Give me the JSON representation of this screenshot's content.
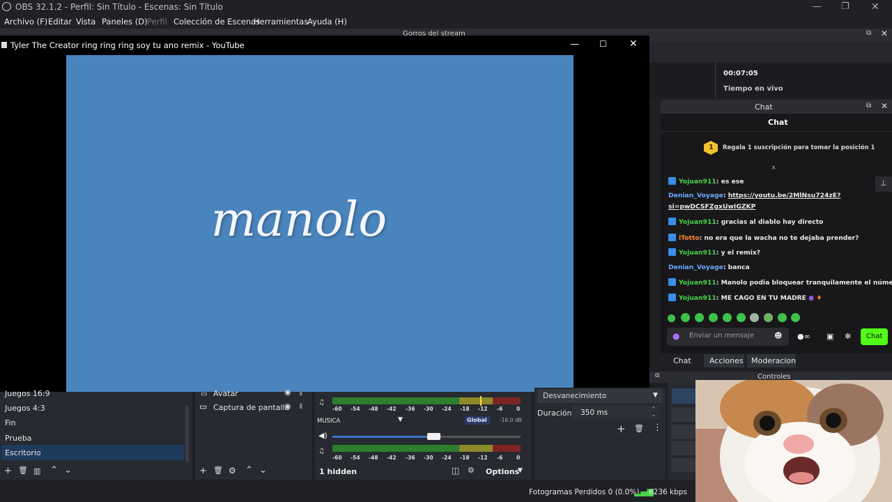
{
  "window": {
    "title": "OBS 32.1.2 - Perfil: Sin Título - Escenas: Sin Título"
  },
  "menu": {
    "items": [
      "Archivo (F)",
      "Editar",
      "Vista",
      "Paneles (D)",
      "Perfil",
      "Colección de Escenas",
      "Herramientas",
      "Ayuda (H)"
    ]
  },
  "bg_dock_title": "Gorros del stream",
  "youtube": {
    "title": "Tyler The Creator ring ring ring soy tu ano remix - YouTube",
    "video_text": "manolo"
  },
  "stats": {
    "time": "00:07:05",
    "live_label": "Tiempo en vivo"
  },
  "chat": {
    "dock_title": "Chat",
    "header": "Chat",
    "sub_rank": "1",
    "sub_text": "Regala 1 suscripción para tomar la posición 1",
    "messages": [
      {
        "user": "Yojuan911",
        "text": ": es ese"
      },
      {
        "user": "Denian_Voyage",
        "text": ": ",
        "link": "https://youtu.be/2MlNsu724zE?",
        "link2": "si=pwDCSFZgxUwIGZKP"
      },
      {
        "user": "Yojuan911",
        "text": ": gracias al diablo hay directo"
      },
      {
        "user": "iTotto",
        "text": ": no era que la wacha no te dejaba prender?"
      },
      {
        "user": "Yojuan911",
        "text": ": y el remix?"
      },
      {
        "user": "Denian_Voyage",
        "text": ": banca"
      },
      {
        "user": "Yojuan911",
        "text": ": Manolo podia bloquear tranquilamente el número"
      },
      {
        "user": "Yojuan911",
        "text": ": ME CAGO EN TU MADRE"
      }
    ],
    "input_placeholder": "Enviar un mensaje",
    "send_label": "Chat",
    "tabs": [
      "Chat",
      "Acciones",
      "Moderacion"
    ]
  },
  "controls": {
    "title": "Controles"
  },
  "scenes": {
    "items": [
      "Juegos 16:9",
      "Juegos 4:3",
      "Fin",
      "Prueba",
      "Escritorio"
    ],
    "selected": "Escritorio"
  },
  "sources": {
    "items": [
      "Avatar",
      "Captura de pantalla"
    ]
  },
  "mixer": {
    "ticks": [
      "-60",
      "-54",
      "-48",
      "-42",
      "-36",
      "-30",
      "-24",
      "-18",
      "-12",
      "-6",
      "0"
    ],
    "track_name": "MUSICA",
    "global_label": "Global",
    "db": "-16.0 dB",
    "hidden": "1 hidden",
    "options": "Options"
  },
  "transitions": {
    "type": "Desvanecimiento",
    "duration_label": "Duración",
    "duration": "350 ms"
  },
  "status": {
    "dropped": "Fotogramas Perdidos 0 (0.0%)",
    "bitrate": "6236 kbps"
  },
  "colors": {
    "accent_green": "#53fc18",
    "selected_scene": "#1e3a5c",
    "video_bg": "#4a84bd"
  }
}
